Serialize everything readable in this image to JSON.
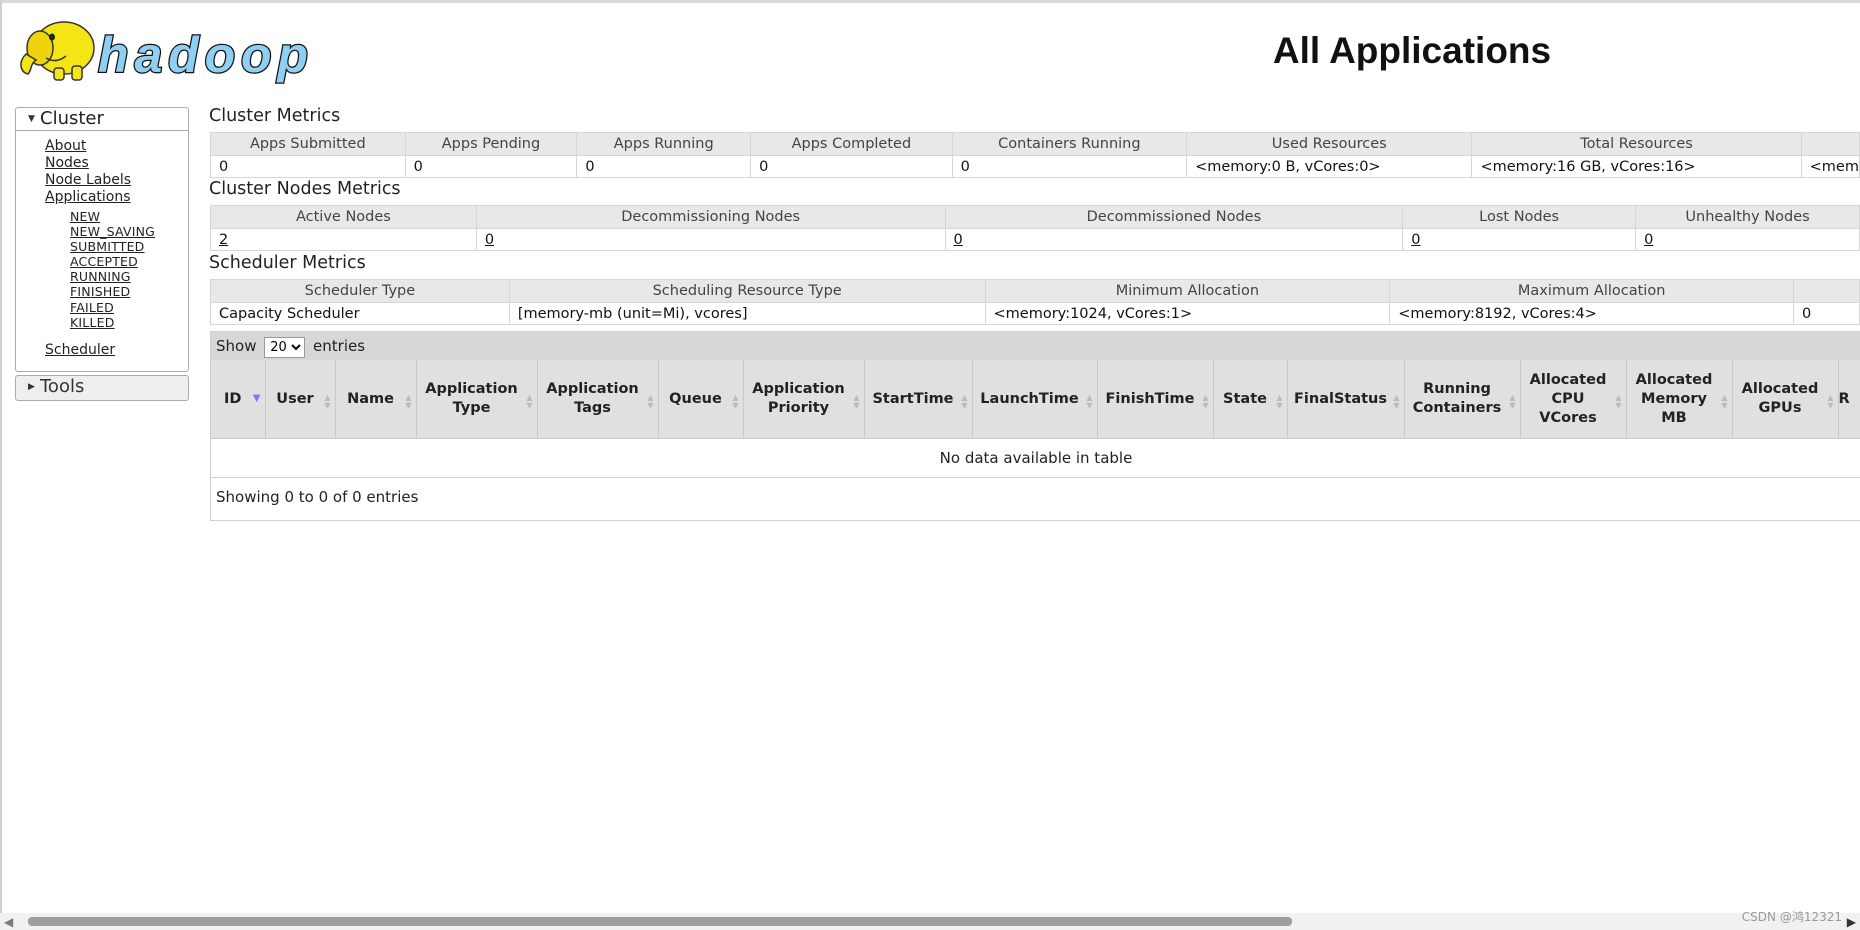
{
  "header": {
    "logo_text": "hadoop",
    "title": "All Applications"
  },
  "sidebar": {
    "cluster": {
      "label": "Cluster",
      "links": [
        "About",
        "Nodes",
        "Node Labels",
        "Applications"
      ],
      "app_states": [
        "NEW",
        "NEW_SAVING",
        "SUBMITTED",
        "ACCEPTED",
        "RUNNING",
        "FINISHED",
        "FAILED",
        "KILLED"
      ],
      "scheduler": "Scheduler"
    },
    "tools": {
      "label": "Tools"
    }
  },
  "cluster_metrics": {
    "title": "Cluster Metrics",
    "headers": [
      "Apps Submitted",
      "Apps Pending",
      "Apps Running",
      "Apps Completed",
      "Containers Running",
      "Used Resources",
      "Total Resources",
      ""
    ],
    "values": [
      "0",
      "0",
      "0",
      "0",
      "0",
      "<memory:0 B, vCores:0>",
      "<memory:16 GB, vCores:16>",
      "<mem"
    ]
  },
  "cluster_nodes_metrics": {
    "title": "Cluster Nodes Metrics",
    "headers": [
      "Active Nodes",
      "Decommissioning Nodes",
      "Decommissioned Nodes",
      "Lost Nodes",
      "Unhealthy Nodes"
    ],
    "values": [
      "2",
      "0",
      "0",
      "0",
      "0"
    ]
  },
  "scheduler_metrics": {
    "title": "Scheduler Metrics",
    "headers": [
      "Scheduler Type",
      "Scheduling Resource Type",
      "Minimum Allocation",
      "Maximum Allocation",
      ""
    ],
    "values": [
      "Capacity Scheduler",
      "[memory-mb (unit=Mi), vcores]",
      "<memory:1024, vCores:1>",
      "<memory:8192, vCores:4>",
      "0"
    ]
  },
  "apps_table": {
    "show_label": "Show",
    "entries_label": "entries",
    "page_size": "20",
    "page_size_options": [
      "20"
    ],
    "columns": [
      "ID",
      "User",
      "Name",
      "Application Type",
      "Application Tags",
      "Queue",
      "Application Priority",
      "StartTime",
      "LaunchTime",
      "FinishTime",
      "State",
      "FinalStatus",
      "Running Containers",
      "Allocated CPU VCores",
      "Allocated Memory MB",
      "Allocated GPUs",
      "R"
    ],
    "empty_message": "No data available in table",
    "info": "Showing 0 to 0 of 0 entries"
  },
  "watermark": "CSDN @鸿12321"
}
